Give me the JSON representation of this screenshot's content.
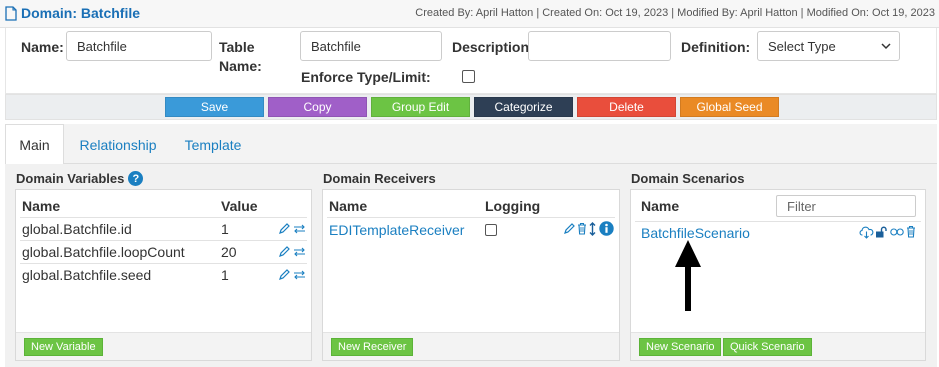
{
  "header": {
    "title": "Domain: Batchfile",
    "meta": "Created By: April Hatton | Created On: Oct 19, 2023 | Modified By: April Hatton | Modified On: Oct 19, 2023"
  },
  "form": {
    "name_label": "Name:",
    "name_value": "Batchfile",
    "table_name_label_1": "Table",
    "table_name_label_2": "Name:",
    "table_name_value": "Batchfile",
    "description_label": "Description:",
    "description_value": "",
    "definition_label": "Definition:",
    "definition_value": "Select Type",
    "enforce_label": "Enforce Type/Limit:"
  },
  "toolbar": {
    "buttons": [
      {
        "label": "Save",
        "color": "#3a9ad9"
      },
      {
        "label": "Copy",
        "color": "#a05fc8"
      },
      {
        "label": "Group Edit",
        "color": "#6cc444"
      },
      {
        "label": "Categorize",
        "color": "#2e3f55"
      },
      {
        "label": "Delete",
        "color": "#e94e3c"
      },
      {
        "label": "Global Seed",
        "color": "#ea8a25"
      }
    ]
  },
  "tabs": [
    {
      "label": "Main"
    },
    {
      "label": "Relationship"
    },
    {
      "label": "Template"
    }
  ],
  "variables": {
    "title": "Domain Variables",
    "col_name": "Name",
    "col_value": "Value",
    "rows": [
      {
        "name": "global.Batchfile.id",
        "value": "1"
      },
      {
        "name": "global.Batchfile.loopCount",
        "value": "20"
      },
      {
        "name": "global.Batchfile.seed",
        "value": "1"
      }
    ],
    "new_button": "New Variable"
  },
  "receivers": {
    "title": "Domain Receivers",
    "col_name": "Name",
    "col_logging": "Logging",
    "rows": [
      {
        "name": "EDITemplateReceiver"
      }
    ],
    "new_button": "New Receiver"
  },
  "scenarios": {
    "title": "Domain Scenarios",
    "col_name": "Name",
    "filter_placeholder": "Filter",
    "rows": [
      {
        "name": "BatchfileScenario"
      }
    ],
    "new_button": "New Scenario",
    "quick_button": "Quick Scenario"
  },
  "colors": {
    "link": "#1a7fc1",
    "accent_green": "#6cc444"
  },
  "icons": [
    "document-icon",
    "help-icon",
    "edit-icon",
    "swap-icon",
    "trash-icon",
    "sort-icon",
    "info-icon",
    "cloud-download-icon",
    "unlock-icon",
    "link-icon",
    "arrow-up-icon"
  ]
}
